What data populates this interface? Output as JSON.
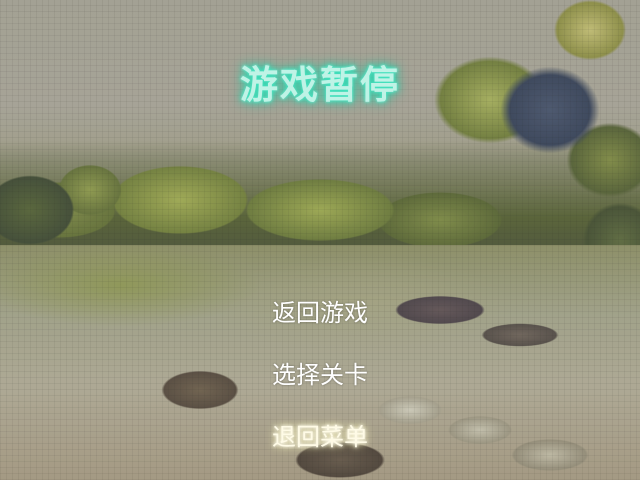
{
  "screen": {
    "title": "游戏暂停",
    "title_color": "#bff3e6",
    "title_glow_color": "#2fd6b0"
  },
  "menu": {
    "items": [
      {
        "label": "返回游戏"
      },
      {
        "label": "选择关卡"
      },
      {
        "label": "退回菜单",
        "selected": true
      }
    ],
    "text_color": "#ffffff"
  }
}
